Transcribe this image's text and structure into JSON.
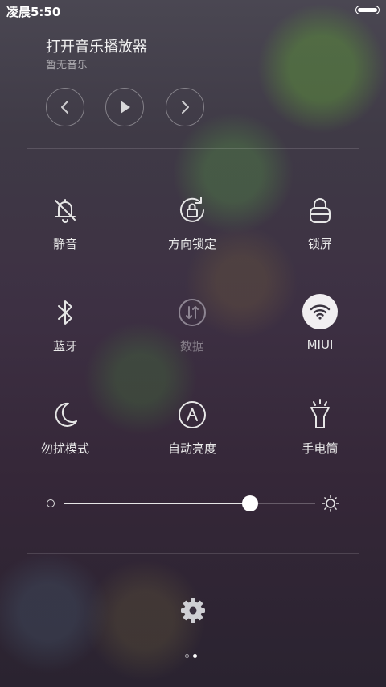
{
  "status": {
    "time": "凌晨5:50"
  },
  "music": {
    "title": "打开音乐播放器",
    "subtitle": "暂无音乐",
    "controls": [
      {
        "name": "previous-button",
        "icon": "chevron-left-icon"
      },
      {
        "name": "play-button",
        "icon": "play-icon"
      },
      {
        "name": "next-button",
        "icon": "chevron-right-icon"
      }
    ]
  },
  "toggles": [
    {
      "label": "静音",
      "icon": "bell-off-icon",
      "state": "off"
    },
    {
      "label": "方向锁定",
      "icon": "rotation-lock-icon",
      "state": "off"
    },
    {
      "label": "锁屏",
      "icon": "lock-icon",
      "state": "off"
    },
    {
      "label": "蓝牙",
      "icon": "bluetooth-icon",
      "state": "off"
    },
    {
      "label": "数据",
      "icon": "mobile-data-icon",
      "state": "disabled"
    },
    {
      "label": "MIUI",
      "icon": "wifi-icon",
      "state": "on"
    },
    {
      "label": "勿扰模式",
      "icon": "moon-icon",
      "state": "off"
    },
    {
      "label": "自动亮度",
      "icon": "auto-brightness-icon",
      "state": "off"
    },
    {
      "label": "手电筒",
      "icon": "flashlight-icon",
      "state": "off"
    }
  ],
  "brightness": {
    "level": 0.74
  },
  "pager": {
    "current": 2,
    "total": 2
  },
  "colors": {
    "active_toggle_bg": "#f1eef1",
    "active_icon": "#3a3340",
    "disabled": "#8d8592"
  }
}
